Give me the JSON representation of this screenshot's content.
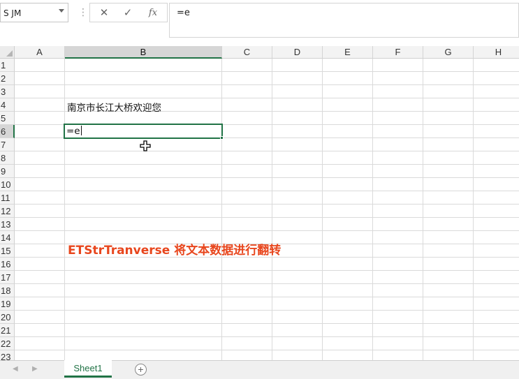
{
  "formula_bar": {
    "name_box": "S JM",
    "sep": "⋮",
    "cancel_icon": "✕",
    "enter_icon": "✓",
    "fx_label": "fx",
    "formula": "=e"
  },
  "columns": [
    "A",
    "B",
    "C",
    "D",
    "E",
    "F",
    "G",
    "H"
  ],
  "rows": [
    "1",
    "2",
    "3",
    "4",
    "5",
    "6",
    "7",
    "8",
    "9",
    "10",
    "11",
    "12",
    "13",
    "14",
    "15",
    "16",
    "17",
    "18",
    "19",
    "20",
    "21",
    "22",
    "23"
  ],
  "active": {
    "column": "B",
    "row": "6"
  },
  "cells": {
    "b4": "南京市长江大桥欢迎您",
    "b6_editing": "=e"
  },
  "banner": "ETStrTranverse 将文本数据进行翻转",
  "tabs": {
    "prev": "◀",
    "next": "▶",
    "sheet1": "Sheet1",
    "add": "+"
  },
  "colors": {
    "accent": "#217346",
    "banner": "#e8461d"
  }
}
